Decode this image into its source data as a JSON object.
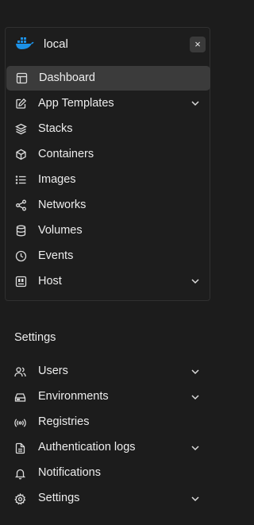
{
  "environment": {
    "name": "local",
    "close_label": "×",
    "items": [
      {
        "label": "Dashboard",
        "icon": "layout-icon",
        "active": true,
        "expandable": false
      },
      {
        "label": "App Templates",
        "icon": "edit-icon",
        "expandable": true
      },
      {
        "label": "Stacks",
        "icon": "layers-icon",
        "expandable": false
      },
      {
        "label": "Containers",
        "icon": "box-icon",
        "expandable": false
      },
      {
        "label": "Images",
        "icon": "list-icon",
        "expandable": false
      },
      {
        "label": "Networks",
        "icon": "share-icon",
        "expandable": false
      },
      {
        "label": "Volumes",
        "icon": "database-icon",
        "expandable": false
      },
      {
        "label": "Events",
        "icon": "clock-icon",
        "expandable": false
      },
      {
        "label": "Host",
        "icon": "host-icon",
        "expandable": true
      }
    ]
  },
  "settings": {
    "title": "Settings",
    "items": [
      {
        "label": "Users",
        "icon": "users-icon",
        "expandable": true
      },
      {
        "label": "Environments",
        "icon": "hard-drive-icon",
        "expandable": true
      },
      {
        "label": "Registries",
        "icon": "radio-icon",
        "expandable": false
      },
      {
        "label": "Authentication logs",
        "icon": "file-text-icon",
        "expandable": true
      },
      {
        "label": "Notifications",
        "icon": "bell-icon",
        "expandable": false
      },
      {
        "label": "Settings",
        "icon": "gear-icon",
        "expandable": true
      }
    ]
  },
  "colors": {
    "background": "#1c1c1c",
    "active_item": "#3b3b3b",
    "docker_blue": "#1d91e6"
  }
}
